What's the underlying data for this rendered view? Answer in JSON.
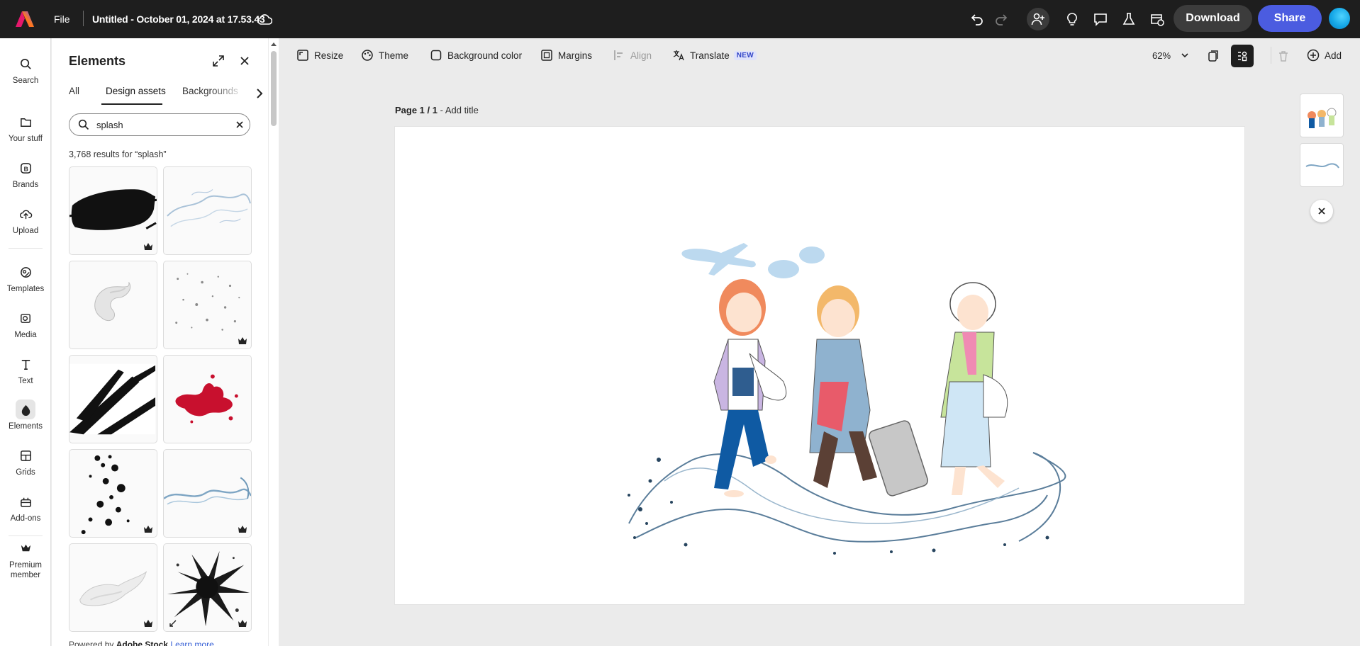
{
  "topbar": {
    "file_label": "File",
    "doc_title": "Untitled - October 01, 2024 at 17.53.43",
    "download_label": "Download",
    "share_label": "Share",
    "brand_color": "#4b5ce0"
  },
  "rail": {
    "items": [
      {
        "label": "Search",
        "icon": "search-icon"
      },
      {
        "label": "Your stuff",
        "icon": "folder-icon"
      },
      {
        "label": "Brands",
        "icon": "brand-icon"
      },
      {
        "label": "Upload",
        "icon": "upload-icon"
      },
      {
        "label": "Templates",
        "icon": "templates-icon"
      },
      {
        "label": "Media",
        "icon": "media-icon"
      },
      {
        "label": "Text",
        "icon": "text-icon"
      },
      {
        "label": "Elements",
        "icon": "elements-icon"
      },
      {
        "label": "Grids",
        "icon": "grid-icon"
      },
      {
        "label": "Add-ons",
        "icon": "addons-icon"
      },
      {
        "label": "Premium member",
        "icon": "crown-icon"
      }
    ],
    "active": "Elements"
  },
  "panel": {
    "title": "Elements",
    "tabs": [
      "All",
      "Design assets",
      "Backgrounds"
    ],
    "active_tab": "Design assets",
    "search_value": "splash",
    "result_count": "3,768 results for “splash”",
    "powered_prefix": "Powered by",
    "powered_brand": "Adobe Stock",
    "learn_more": "Learn more"
  },
  "toolbar": {
    "resize": "Resize",
    "theme": "Theme",
    "background_color": "Background color",
    "margins": "Margins",
    "align": "Align",
    "translate": "Translate",
    "translate_badge": "NEW",
    "zoom": "62%",
    "add": "Add"
  },
  "canvas": {
    "page_label": "Page 1 / 1",
    "page_separator": " - ",
    "add_title": "Add title"
  }
}
